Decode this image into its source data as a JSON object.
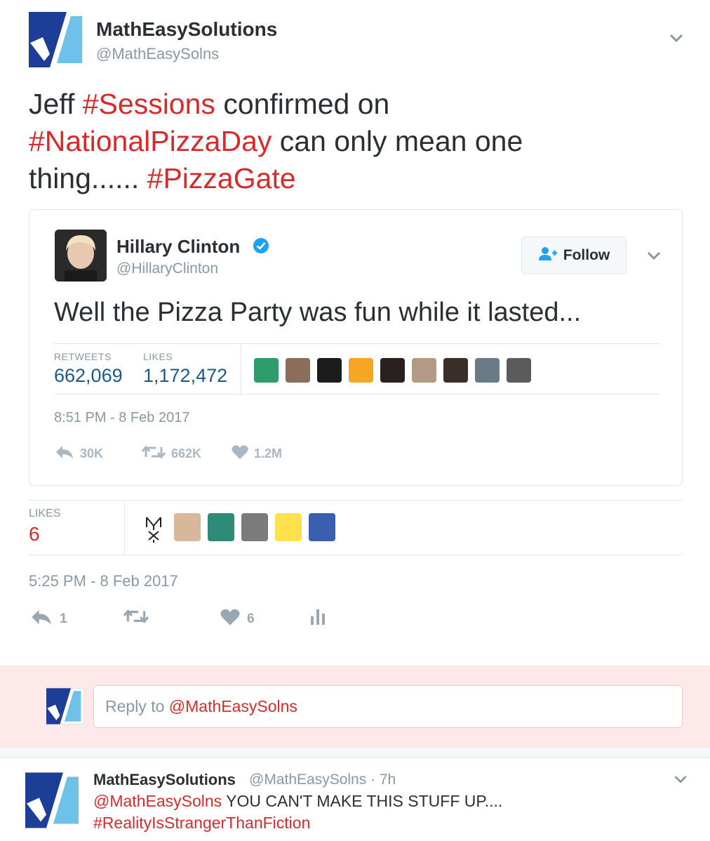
{
  "author": {
    "name": "MathEasySolutions",
    "handle": "@MathEasySolns"
  },
  "tweet": {
    "text_parts": [
      "Jeff ",
      "#Sessions",
      " confirmed on",
      "#NationalPizzaDay",
      " can only mean one",
      "thing...... ",
      "#PizzaGate"
    ]
  },
  "quoted_tweet": {
    "name": "Hillary Clinton",
    "handle": "@HillaryClinton",
    "follow_label": "Follow",
    "text": "Well the Pizza Party was fun while it lasted...",
    "retweets_label": "RETWEETS",
    "retweets_value": "662,069",
    "likes_label": "LIKES",
    "likes_value": "1,172,472",
    "timestamp": "8:51 PM - 8 Feb 2017",
    "actions": {
      "reply": "30K",
      "retweet": "662K",
      "like": "1.2M"
    },
    "liker_avatar_colors": [
      "#2e9d6b",
      "#8a6d5a",
      "#1c1c1c",
      "#f5a623",
      "#2a2020",
      "#b49a85",
      "#3a2e28",
      "#6a7a88",
      "#5b5b5b"
    ]
  },
  "main_stats": {
    "likes_label": "LIKES",
    "likes_value": "6",
    "timestamp": "5:25 PM - 8 Feb 2017",
    "actions": {
      "reply": "1",
      "like": "6"
    },
    "liker_avatar_colors": [
      "#d8b89a",
      "#2e8b78",
      "#7b7b7b",
      "#ffe14d",
      "#3a5fb0"
    ]
  },
  "reply_box": {
    "placeholder_prefix": "Reply to ",
    "placeholder_handle": "@MathEasySolns"
  },
  "reply_tweet": {
    "name": "MathEasySolutions",
    "meta": "@MathEasySolns · 7h",
    "mention": "@MathEasySolns",
    "text": " YOU CAN'T MAKE THIS STUFF UP....",
    "hashtag": "#RealityIsStrangerThanFiction"
  },
  "colors": {
    "accent_red": "#d62b2b",
    "stat_blue": "#1b5a88",
    "logo_blue": "#1d3e97",
    "reply_band": "#fde9e9"
  }
}
